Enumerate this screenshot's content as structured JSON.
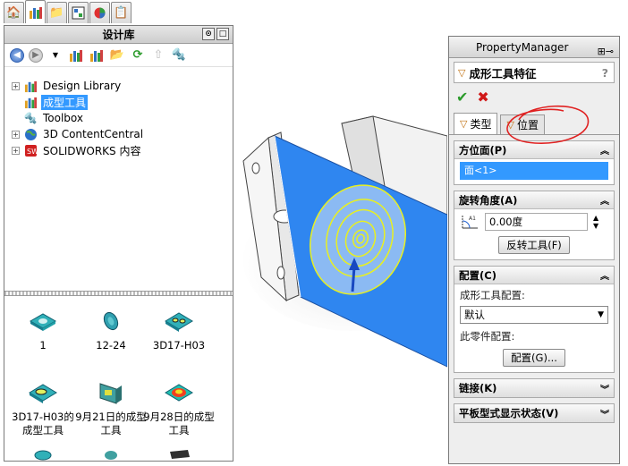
{
  "top_tabs": [
    {
      "icon": "home-icon"
    },
    {
      "icon": "design-library-icon"
    },
    {
      "icon": "folder-icon"
    },
    {
      "icon": "view-palette-icon"
    },
    {
      "icon": "appearances-icon"
    },
    {
      "icon": "custom-properties-icon"
    }
  ],
  "design_library": {
    "title": "设计库",
    "tree": [
      {
        "label": "Design Library",
        "icon": "design-library-icon",
        "expandable": true
      },
      {
        "label": "成型工具",
        "icon": "design-library-icon",
        "expandable": false,
        "selected": true
      },
      {
        "label": "Toolbox",
        "icon": "toolbox-icon",
        "expandable": false
      },
      {
        "label": "3D ContentCentral",
        "icon": "globe-icon",
        "expandable": true
      },
      {
        "label": "SOLIDWORKS 内容",
        "icon": "solidworks-icon",
        "expandable": true
      }
    ],
    "thumbnails": [
      {
        "label": "1"
      },
      {
        "label": "12-24"
      },
      {
        "label": "3D17-H03"
      },
      {
        "label": "3D17-H03的成型工具"
      },
      {
        "label": "9月21日的成型工具"
      },
      {
        "label": "9月28日的成型工具"
      }
    ]
  },
  "property_manager": {
    "title": "PropertyManager",
    "feature_title": "成形工具特征",
    "help": "?",
    "ok_symbol": "✔",
    "cancel_symbol": "✖",
    "tabs": [
      {
        "label": "类型",
        "active": true
      },
      {
        "label": "位置",
        "active": false
      }
    ],
    "orientation": {
      "header": "方位面(P)",
      "face": "面<1>"
    },
    "rotation": {
      "header": "旋转角度(A)",
      "value": "0.00度",
      "flip_button": "反转工具(F)"
    },
    "config": {
      "header": "配置(C)",
      "tool_config_label": "成形工具配置:",
      "tool_config_value": "默认",
      "part_config_label": "此零件配置:",
      "config_button": "配置(G)..."
    },
    "link": {
      "header": "链接(K)"
    },
    "flat_state": {
      "header": "平板型式显示状态(V)"
    }
  },
  "colors": {
    "selection": "#3399ff",
    "face_blue": "#2f86f0",
    "highlight_yellow": "#e8f020",
    "annotation_red": "#e02020"
  }
}
